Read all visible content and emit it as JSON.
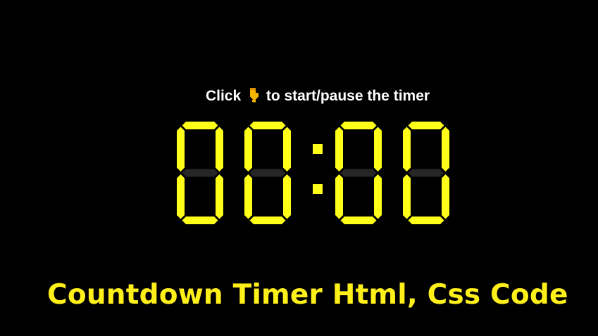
{
  "instruction": {
    "before": "Click",
    "icon": "pointing-down-hand-icon",
    "after": "to start/pause the timer"
  },
  "timer": {
    "display": "00:00",
    "minutes": "00",
    "seconds": "00",
    "segment_on_color": "#ffff1a",
    "segment_off_color": "#262626"
  },
  "caption": {
    "text": "Countdown Timer Html, Css Code",
    "color": "#fff01a"
  },
  "colors": {
    "background": "#000000",
    "instruction_text": "#ffffff",
    "icon": "#f4b400"
  }
}
